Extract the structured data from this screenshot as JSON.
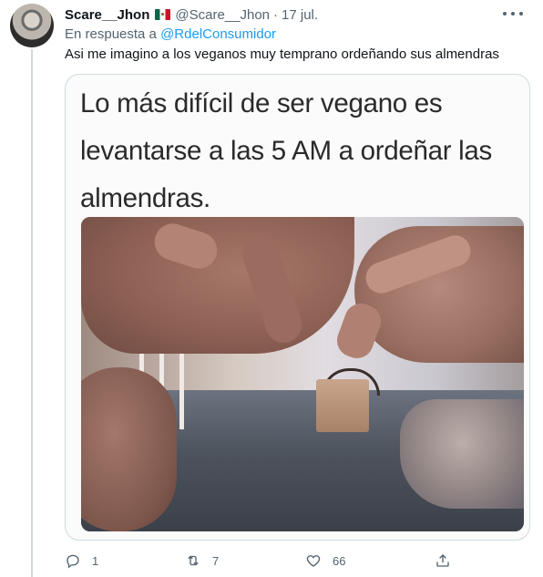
{
  "tweet": {
    "author": {
      "display_name": "Scare__Jhon",
      "flag_icon": "mexico-flag-icon",
      "handle": "@Scare__Jhon",
      "separator": "·",
      "date": "17 jul."
    },
    "reply_to": {
      "prefix": "En respuesta a ",
      "mention": "@RdelConsumidor"
    },
    "text": "Asi me imagino a los veganos muy temprano ordeñando sus almendras",
    "media": {
      "meme_lines": [
        "Lo más difícil de ser vegano es",
        "levantarse a las 5 AM a ordeñar las",
        "almendras."
      ]
    },
    "actions": {
      "reply": {
        "icon": "reply-icon",
        "count": "1"
      },
      "retweet": {
        "icon": "retweet-icon",
        "count": "7"
      },
      "like": {
        "icon": "heart-icon",
        "count": "66"
      },
      "share": {
        "icon": "share-icon"
      }
    },
    "colors": {
      "link": "#1d9bf0",
      "secondary_text": "#536471",
      "primary_text": "#0f1419",
      "border": "#cfd9de"
    }
  }
}
